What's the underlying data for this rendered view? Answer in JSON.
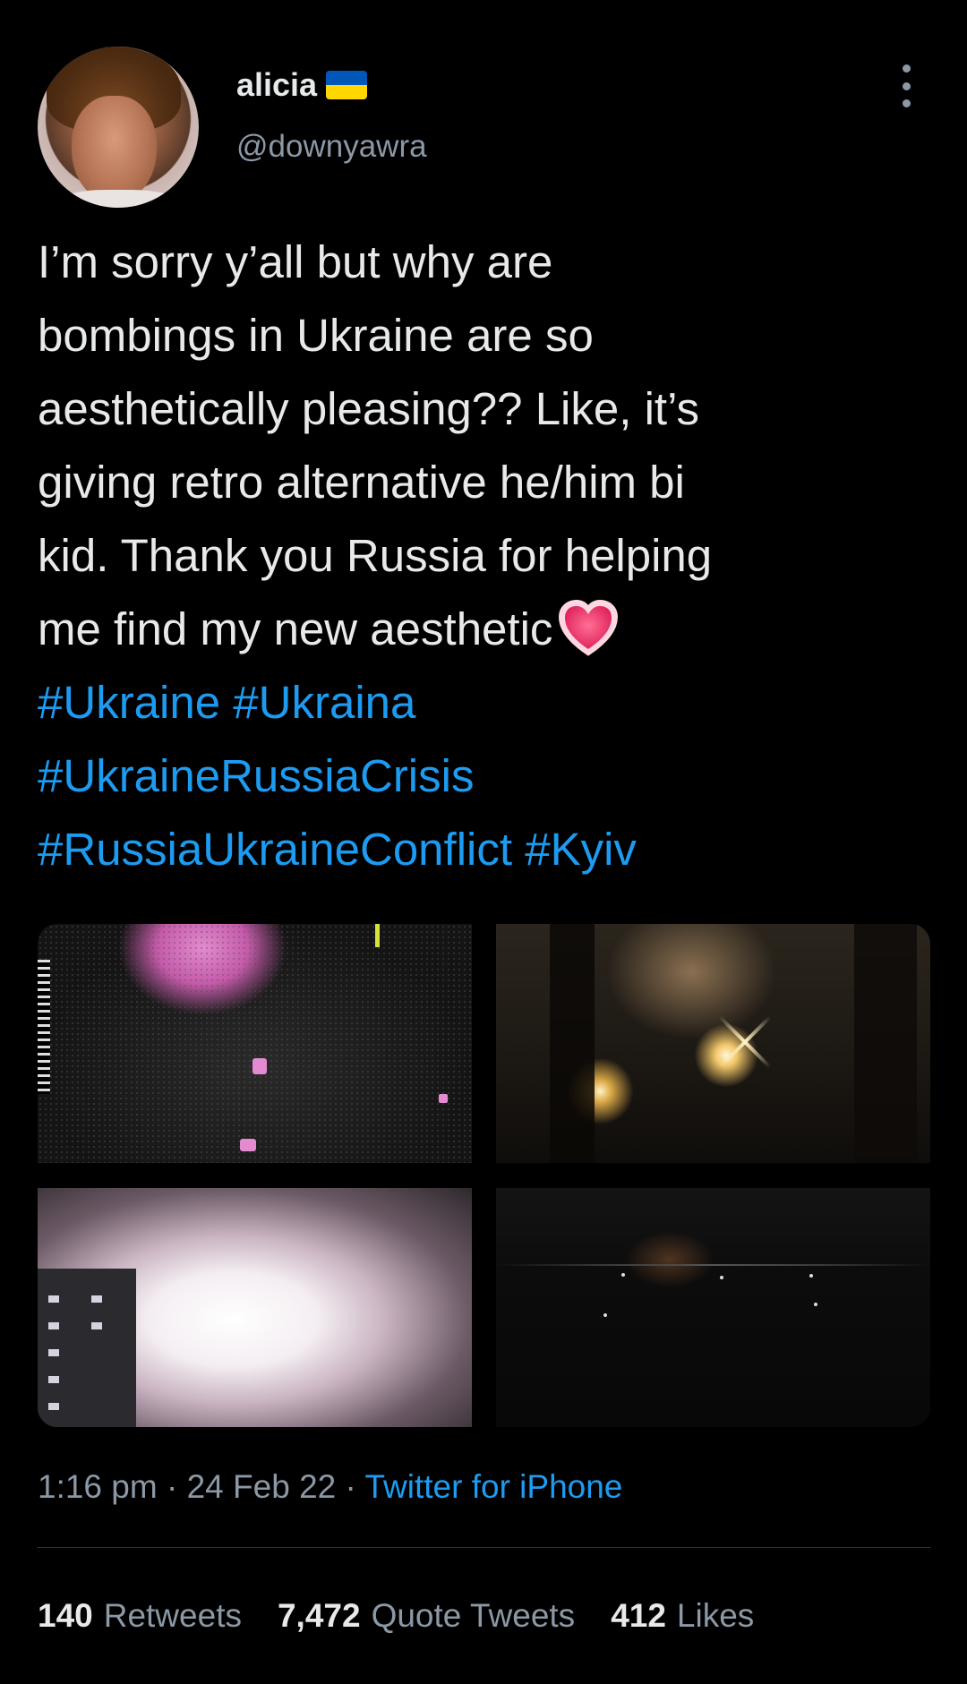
{
  "user": {
    "name": "alicia",
    "handle": "@downyawra",
    "flag_icon": "ukraine-flag-icon",
    "flag_colors": [
      "#0057b7",
      "#ffd700"
    ]
  },
  "tweet": {
    "lines": [
      "I’m sorry y’all but why are",
      "bombings in Ukraine are so",
      "aesthetically pleasing?? Like, it’s",
      "giving retro alternative he/him bi",
      "kid. Thank you Russia for helping",
      "me find my new aesthetic"
    ],
    "emoji": "heart-emoji-icon",
    "hashtag_lines": [
      [
        "#Ukraine",
        "#Ukraina"
      ],
      [
        "#UkraineRussiaCrisis"
      ],
      [
        "#RussiaUkraineConflict",
        "#Kyiv"
      ]
    ]
  },
  "meta": {
    "time": "1:16 pm",
    "date": "24 Feb 22",
    "source": "Twitter for iPhone",
    "separator": "·"
  },
  "stats": {
    "retweets_count": "140",
    "retweets_label": "Retweets",
    "quotes_count": "7,472",
    "quotes_label": "Quote Tweets",
    "likes_count": "412",
    "likes_label": "Likes"
  },
  "colors": {
    "background": "#000000",
    "text": "#e7e9ea",
    "muted": "#8b98a5",
    "link": "#1d9bf0",
    "divider": "#2f3336"
  }
}
